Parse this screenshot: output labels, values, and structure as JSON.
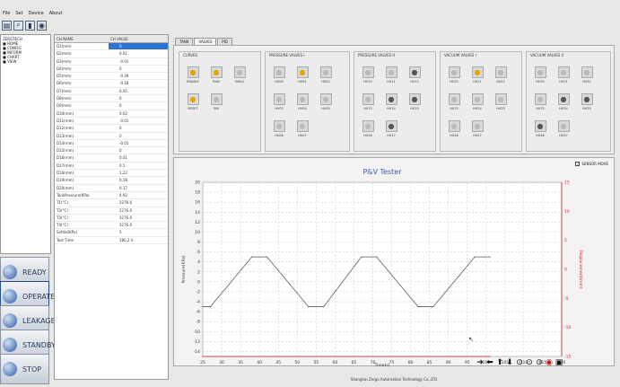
{
  "menu": [
    "File",
    "Set",
    "Device",
    "About"
  ],
  "tree": [
    "ZERGTECH",
    "HOME",
    "CONFIG",
    "INFORM",
    "CHART",
    "VIEW"
  ],
  "side_buttons": [
    {
      "label": "READY"
    },
    {
      "label": "OPERATE"
    },
    {
      "label": "LEAKAGE"
    },
    {
      "label": "STANDBY"
    },
    {
      "label": "STOP"
    }
  ],
  "grid": {
    "col1": "CH NAME",
    "col2": "CH VALUE",
    "rows": [
      {
        "name": "D1(mm)",
        "value": "0"
      },
      {
        "name": "D2(mm)",
        "value": "0.01"
      },
      {
        "name": "D3(mm)",
        "value": "-0.01"
      },
      {
        "name": "D4(mm)",
        "value": "0"
      },
      {
        "name": "D5(mm)",
        "value": "-0.39"
      },
      {
        "name": "D6(mm)",
        "value": "-0.18"
      },
      {
        "name": "D7(mm)",
        "value": "0.05"
      },
      {
        "name": "D8(mm)",
        "value": "0"
      },
      {
        "name": "D9(mm)",
        "value": "0"
      },
      {
        "name": "D10(mm)",
        "value": "0.02"
      },
      {
        "name": "D11(mm)",
        "value": "-0.01"
      },
      {
        "name": "D12(mm)",
        "value": "0"
      },
      {
        "name": "D13(mm)",
        "value": "0"
      },
      {
        "name": "D14(mm)",
        "value": "-0.01"
      },
      {
        "name": "D15(mm)",
        "value": "0"
      },
      {
        "name": "D16(mm)",
        "value": "0.01"
      },
      {
        "name": "D17(mm)",
        "value": "0.1"
      },
      {
        "name": "D18(mm)",
        "value": "1.22"
      },
      {
        "name": "D19(mm)",
        "value": "0.18"
      },
      {
        "name": "D20(mm)",
        "value": "0.17"
      },
      {
        "name": "TankPressure(KPa)",
        "value": "4.92"
      },
      {
        "name": "T1(°C)",
        "value": "2276.6"
      },
      {
        "name": "T2(°C)",
        "value": "2276.6"
      },
      {
        "name": "T3(°C)",
        "value": "3276.6"
      },
      {
        "name": "T4(°C)",
        "value": "3276.6"
      },
      {
        "name": "SetVal(KPa)",
        "value": "5"
      },
      {
        "name": "Test Time",
        "value": "180.2 S"
      }
    ]
  },
  "tabs": [
    "TANK",
    "VALVES",
    "PID"
  ],
  "valve_groups": [
    {
      "label": "CURVES",
      "items": [
        {
          "label": "ENABLE",
          "state": "on"
        },
        {
          "label": "RUN",
          "state": "on"
        },
        {
          "label": "HMLO",
          "state": "off"
        },
        {
          "label": "RESET",
          "state": "on"
        },
        {
          "label": "SIN",
          "state": "off"
        }
      ]
    },
    {
      "label": "PRESSURE VALVES I",
      "items": [
        {
          "label": "HV00",
          "state": "off"
        },
        {
          "label": "HV01",
          "state": "on"
        },
        {
          "label": "HV02",
          "state": "off"
        },
        {
          "label": "HV03",
          "state": "off"
        },
        {
          "label": "HV04",
          "state": "off"
        },
        {
          "label": "HV05",
          "state": "off"
        },
        {
          "label": "HV06",
          "state": "off"
        },
        {
          "label": "HV07",
          "state": "off"
        }
      ]
    },
    {
      "label": "PRESSURE VALVES II",
      "items": [
        {
          "label": "HV10",
          "state": "off"
        },
        {
          "label": "HV11",
          "state": "off"
        },
        {
          "label": "HV12",
          "state": "dark"
        },
        {
          "label": "HV13",
          "state": "off"
        },
        {
          "label": "HV14",
          "state": "dark"
        },
        {
          "label": "HV15",
          "state": "dark"
        },
        {
          "label": "HV16",
          "state": "off"
        },
        {
          "label": "HV17",
          "state": "dark"
        }
      ]
    },
    {
      "label": "VACUUM VALVES I",
      "items": [
        {
          "label": "HV20",
          "state": "off"
        },
        {
          "label": "HV21",
          "state": "on"
        },
        {
          "label": "HV22",
          "state": "off"
        },
        {
          "label": "HV23",
          "state": "off"
        },
        {
          "label": "HV24",
          "state": "off"
        },
        {
          "label": "HV25",
          "state": "off"
        },
        {
          "label": "HV26",
          "state": "off"
        },
        {
          "label": "HV27",
          "state": "off"
        }
      ]
    },
    {
      "label": "VACUUM VALVES II",
      "items": [
        {
          "label": "HV30",
          "state": "off"
        },
        {
          "label": "HV31",
          "state": "off"
        },
        {
          "label": "HV32",
          "state": "off"
        },
        {
          "label": "HV33",
          "state": "off"
        },
        {
          "label": "HV34",
          "state": "dark"
        },
        {
          "label": "HV35",
          "state": "dark"
        },
        {
          "label": "HV36",
          "state": "dark"
        },
        {
          "label": "HV37",
          "state": "off"
        }
      ]
    }
  ],
  "sensor_move_label": "SENSOR MOVE",
  "chart_data": {
    "type": "line",
    "title": "P&V Tester",
    "xlabel": "Time(s)",
    "ylabel": "Pressure(KPa)",
    "y2label": "Displacement(mm)",
    "xlim": [
      25,
      120
    ],
    "ylim": [
      -15,
      20
    ],
    "y2lim": [
      -15,
      15
    ],
    "xticks": [
      25,
      30,
      35,
      40,
      45,
      50,
      55,
      60,
      65,
      70,
      75,
      80,
      85,
      90,
      95,
      100,
      105,
      110,
      115,
      120
    ],
    "yticks": [
      20,
      18,
      16,
      14,
      12,
      10,
      8,
      6,
      4,
      2,
      0,
      -2,
      -4,
      -6,
      -8,
      -10,
      -12,
      -14
    ],
    "y2ticks": [
      15,
      10,
      5,
      0,
      -5,
      -10,
      -15
    ],
    "grid": true,
    "series": [
      {
        "name": "",
        "color": "#5a5a5a",
        "x": [
          25,
          27,
          38,
          42,
          53,
          57,
          67,
          71,
          82,
          86,
          97,
          101
        ],
        "y": [
          -5,
          -5,
          5,
          5,
          -5,
          -5,
          5,
          5,
          -5,
          -5,
          5,
          5
        ]
      },
      {
        "name": "",
        "color": "#cc2222",
        "x": [
          25,
          101
        ],
        "y": [
          -15,
          -15
        ]
      }
    ]
  },
  "status_text": "Shanghai Zergo Automation Technology Co.,LTD",
  "controls": [
    "move-right",
    "move-left",
    "move-up",
    "move-down",
    "play",
    "pause",
    "stop",
    "record",
    "print"
  ]
}
